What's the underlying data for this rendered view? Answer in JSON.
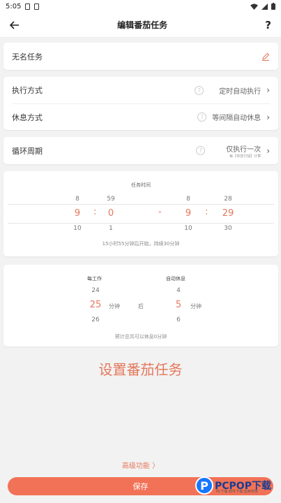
{
  "status": {
    "time": "5:05"
  },
  "app_bar": {
    "title": "编辑番茄任务",
    "help": "?"
  },
  "task_name": {
    "value": "无名任务"
  },
  "settings": {
    "exec_mode": {
      "label": "执行方式",
      "value": "定时自动执行"
    },
    "rest_mode": {
      "label": "休息方式",
      "value": "等间隔自动休息"
    }
  },
  "cycle": {
    "label": "循环周期",
    "value": "仅执行一次",
    "sub": "每【存放付钱】计算"
  },
  "task_time": {
    "title": "任务时间",
    "start": {
      "hour_prev": "8",
      "hour": "9",
      "hour_next": "10",
      "min_prev": "59",
      "min": "0",
      "min_next": "1"
    },
    "end": {
      "hour_prev": "8",
      "hour": "9",
      "hour_next": "10",
      "min_prev": "28",
      "min": "29",
      "min_next": "30"
    },
    "colon": ":",
    "dash": "-",
    "hint": "15小时55分钟后开始，持续30分钟"
  },
  "work_rest": {
    "work_label": "每工作",
    "rest_label": "自动休息",
    "work": {
      "prev": "24",
      "value": "25",
      "next": "26"
    },
    "rest": {
      "prev": "4",
      "value": "5",
      "next": "6"
    },
    "unit": "分钟",
    "after": "后",
    "hint": "预计总共可以休息0分钟"
  },
  "headline": "设置番茄任务",
  "advanced": "高级功能 〉",
  "save": "保存",
  "watermark": {
    "text": "PCPOP下载",
    "sub": "PC下载·软件下载·应用市场"
  }
}
